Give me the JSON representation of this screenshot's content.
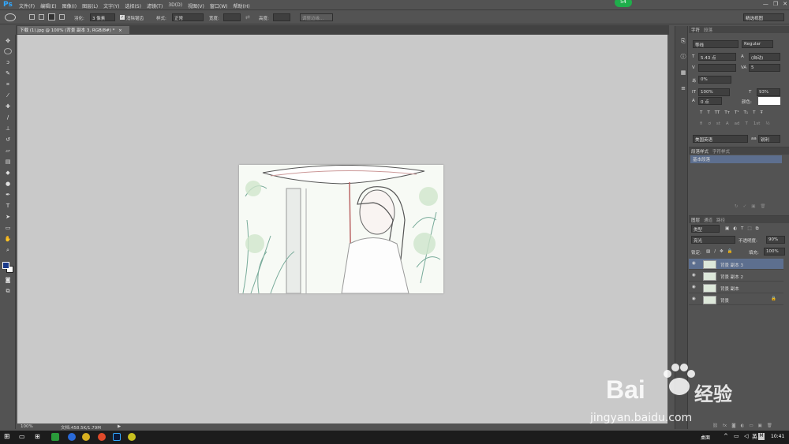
{
  "app": {
    "logo": "Ps",
    "menus": [
      "文件(F)",
      "编辑(E)",
      "图像(I)",
      "图层(L)",
      "文字(Y)",
      "选择(S)",
      "滤镜(T)",
      "3D(D)",
      "视图(V)",
      "窗口(W)",
      "帮助(H)"
    ],
    "badge": "54"
  },
  "options": {
    "feather_label": "羽化:",
    "feather_value": "3 像素",
    "antialias_label": "消除锯齿",
    "style_label": "样式:",
    "style_value": "正常",
    "width_label": "宽度:",
    "height_label": "高度:",
    "refine_edge": "调整边缘...",
    "workspace": "精选视图"
  },
  "document": {
    "tab_title": "下载 (1).jpg @ 100% (背景 副本 3, RGB/8#) *",
    "close": "×"
  },
  "status": {
    "zoom": "100%",
    "doc_info": "文档:458.5K/1.79M"
  },
  "character_panel": {
    "tabs": [
      "字符",
      "段落"
    ],
    "font_family": "等线",
    "font_style": "Regular",
    "font_size": "5.43 点",
    "leading": "(自动)",
    "kerning": "",
    "tracking": "5",
    "baseline_scale": "0%",
    "vscale": "100%",
    "hscale": "93%",
    "baseline_shift": "0 点",
    "color_label": "颜色:",
    "language": "美国英语",
    "antialias": "锐利",
    "type_styles": [
      "T",
      "T",
      "TT",
      "Tт",
      "T¹",
      "T₁",
      "T",
      "Ŧ"
    ],
    "ot_features": [
      "fi",
      "ơ",
      "st",
      "A",
      "ad",
      "T",
      "1st",
      "½"
    ]
  },
  "para_styles_panel": {
    "tabs": [
      "段落样式",
      "字符样式"
    ],
    "item": "基本段落"
  },
  "layers_panel": {
    "tabs": [
      "图层",
      "通道",
      "路径"
    ],
    "filter": "类型",
    "blend_mode": "亮光",
    "opacity_label": "不透明度:",
    "opacity": "90%",
    "lock_label": "锁定:",
    "fill_label": "填充:",
    "fill": "100%",
    "layers": [
      {
        "name": "背景 副本 3",
        "selected": true
      },
      {
        "name": "背景 副本 2",
        "selected": false
      },
      {
        "name": "背景 副本",
        "selected": false
      },
      {
        "name": "背景",
        "selected": false
      }
    ]
  },
  "taskbar": {
    "desktop": "桌面",
    "ime": "英",
    "time": "10:41"
  },
  "watermark": {
    "brand": "Bai",
    "brand2": "经验",
    "url": "jingyan.baidu.com"
  },
  "colors": {
    "ps_blue": "#31a8ff",
    "selected_layer": "#5d6f8f",
    "badge": "#1fae4b",
    "fg_color": "#1a3a8a"
  }
}
